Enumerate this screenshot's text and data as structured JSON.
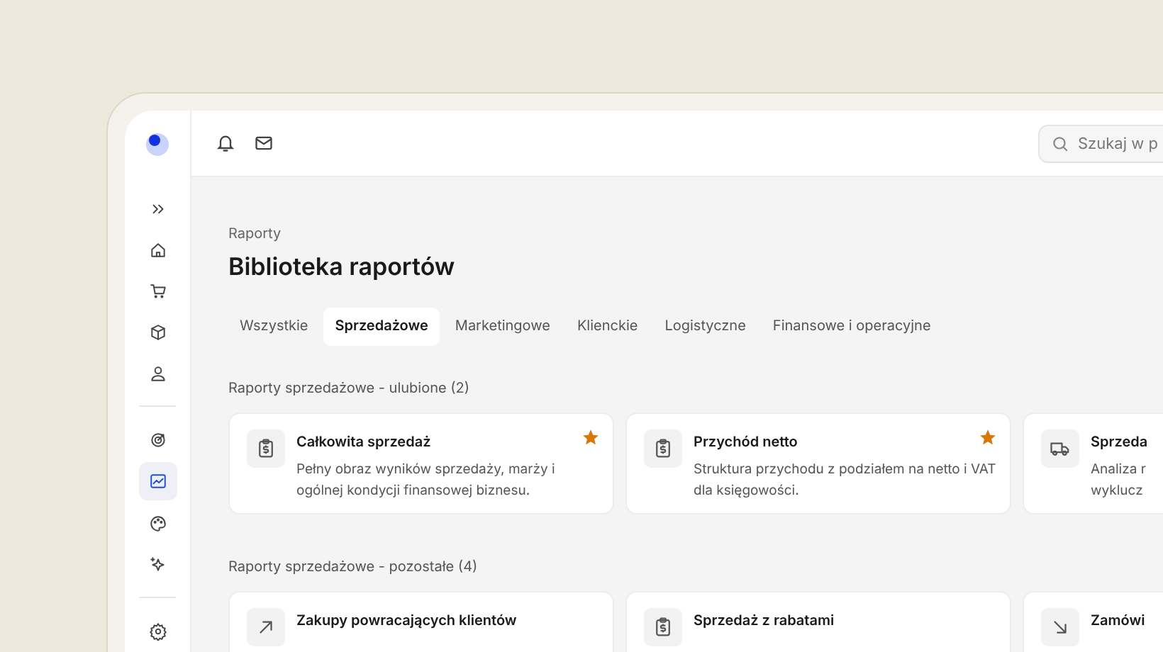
{
  "sidebar": {
    "items": [
      {
        "selected": false
      },
      {
        "selected": false
      },
      {
        "selected": false
      },
      {
        "selected": false
      },
      {
        "selected": false
      },
      {
        "selected": false
      },
      {
        "selected": true
      },
      {
        "selected": false
      },
      {
        "selected": false
      },
      {
        "selected": false
      }
    ]
  },
  "search": {
    "placeholder": "Szukaj w p"
  },
  "breadcrumb": "Raporty",
  "title": "Biblioteka raportów",
  "tabs": [
    {
      "label": "Wszystkie",
      "selected": false
    },
    {
      "label": "Sprzedażowe",
      "selected": true
    },
    {
      "label": "Marketingowe",
      "selected": false
    },
    {
      "label": "Klienckie",
      "selected": false
    },
    {
      "label": "Logistyczne",
      "selected": false
    },
    {
      "label": "Finansowe i operacyjne",
      "selected": false
    }
  ],
  "sections": [
    {
      "heading": "Raporty sprzedażowe - ulubione (2)",
      "cards": [
        {
          "title": "Całkowita sprzedaż",
          "description": "Pełny obraz wyników sprzedaży, marży i ogólnej kondycji finansowej biznesu.",
          "favorite": true
        },
        {
          "title": "Przychód netto",
          "description": "Struktura przychodu z podziałem na netto i VAT dla księgowości.",
          "favorite": true
        },
        {
          "title": "Sprzeda",
          "lines": [
            "Analiza r",
            "wyklucz"
          ],
          "favorite": false
        }
      ]
    },
    {
      "heading": "Raporty sprzedażowe - pozostałe (4)",
      "cards": [
        {
          "title": "Zakupy powracających klientów",
          "favorite": false
        },
        {
          "title": "Sprzedaż z rabatami",
          "favorite": false
        },
        {
          "title": "Zamówi",
          "favorite": false
        }
      ]
    }
  ]
}
